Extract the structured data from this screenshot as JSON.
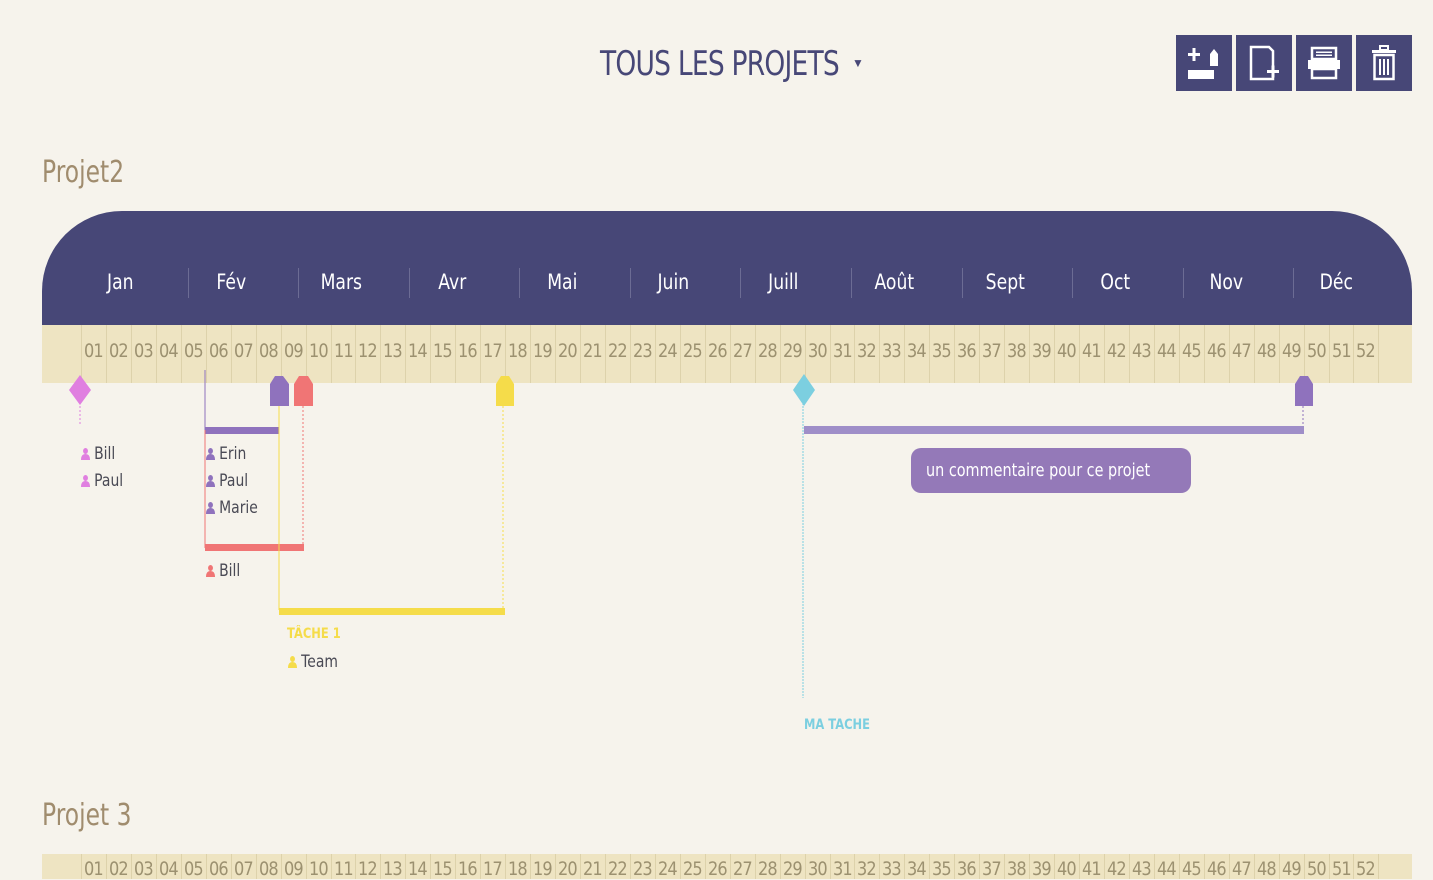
{
  "header": {
    "title": "TOUS LES PROJETS",
    "caret": "▼",
    "toolbar": [
      {
        "name": "add-task-button",
        "icon": "add-task-icon"
      },
      {
        "name": "new-document-button",
        "icon": "new-document-icon"
      },
      {
        "name": "print-button",
        "icon": "print-icon"
      },
      {
        "name": "delete-button",
        "icon": "trash-icon"
      }
    ]
  },
  "months": [
    "Jan",
    "Fév",
    "Mars",
    "Avr",
    "Mai",
    "Juin",
    "Juill",
    "Août",
    "Sept",
    "Oct",
    "Nov",
    "Déc"
  ],
  "weeks": [
    "01",
    "02",
    "03",
    "04",
    "05",
    "06",
    "07",
    "08",
    "09",
    "10",
    "11",
    "12",
    "13",
    "14",
    "15",
    "16",
    "17",
    "18",
    "19",
    "20",
    "21",
    "22",
    "23",
    "24",
    "25",
    "26",
    "27",
    "28",
    "29",
    "30",
    "31",
    "32",
    "33",
    "34",
    "35",
    "36",
    "37",
    "38",
    "39",
    "40",
    "41",
    "42",
    "43",
    "44",
    "45",
    "46",
    "47",
    "48",
    "49",
    "50",
    "51",
    "52"
  ],
  "colors": {
    "navy": "#474777",
    "pink": "#e07fe0",
    "purple": "#8f72bd",
    "salmon": "#f07575",
    "yellow": "#f5dc4a",
    "cyan": "#7ccfe0",
    "lavender": "#9f8ec8"
  },
  "projects": [
    {
      "title": "Projet2",
      "milestones": [
        {
          "week": 1,
          "color": "pink",
          "shape": "diamond",
          "people": [
            "Bill",
            "Paul"
          ]
        },
        {
          "week": 29,
          "color": "cyan",
          "shape": "diamond",
          "label": "MA TACHE"
        }
      ],
      "tasks": [
        {
          "start": 6,
          "end": 8,
          "color": "purple",
          "people": [
            "Erin",
            "Paul",
            "Marie"
          ]
        },
        {
          "start": 6,
          "end": 9,
          "color": "salmon",
          "people": [
            "Bill"
          ]
        },
        {
          "start": 8,
          "end": 17,
          "color": "yellow",
          "label": "TÂCHE 1",
          "people": [
            "Team"
          ]
        },
        {
          "start": 29,
          "end": 49,
          "color": "lavender",
          "comment": "un commentaire pour ce projet"
        }
      ]
    },
    {
      "title": "Projet 3"
    }
  ]
}
